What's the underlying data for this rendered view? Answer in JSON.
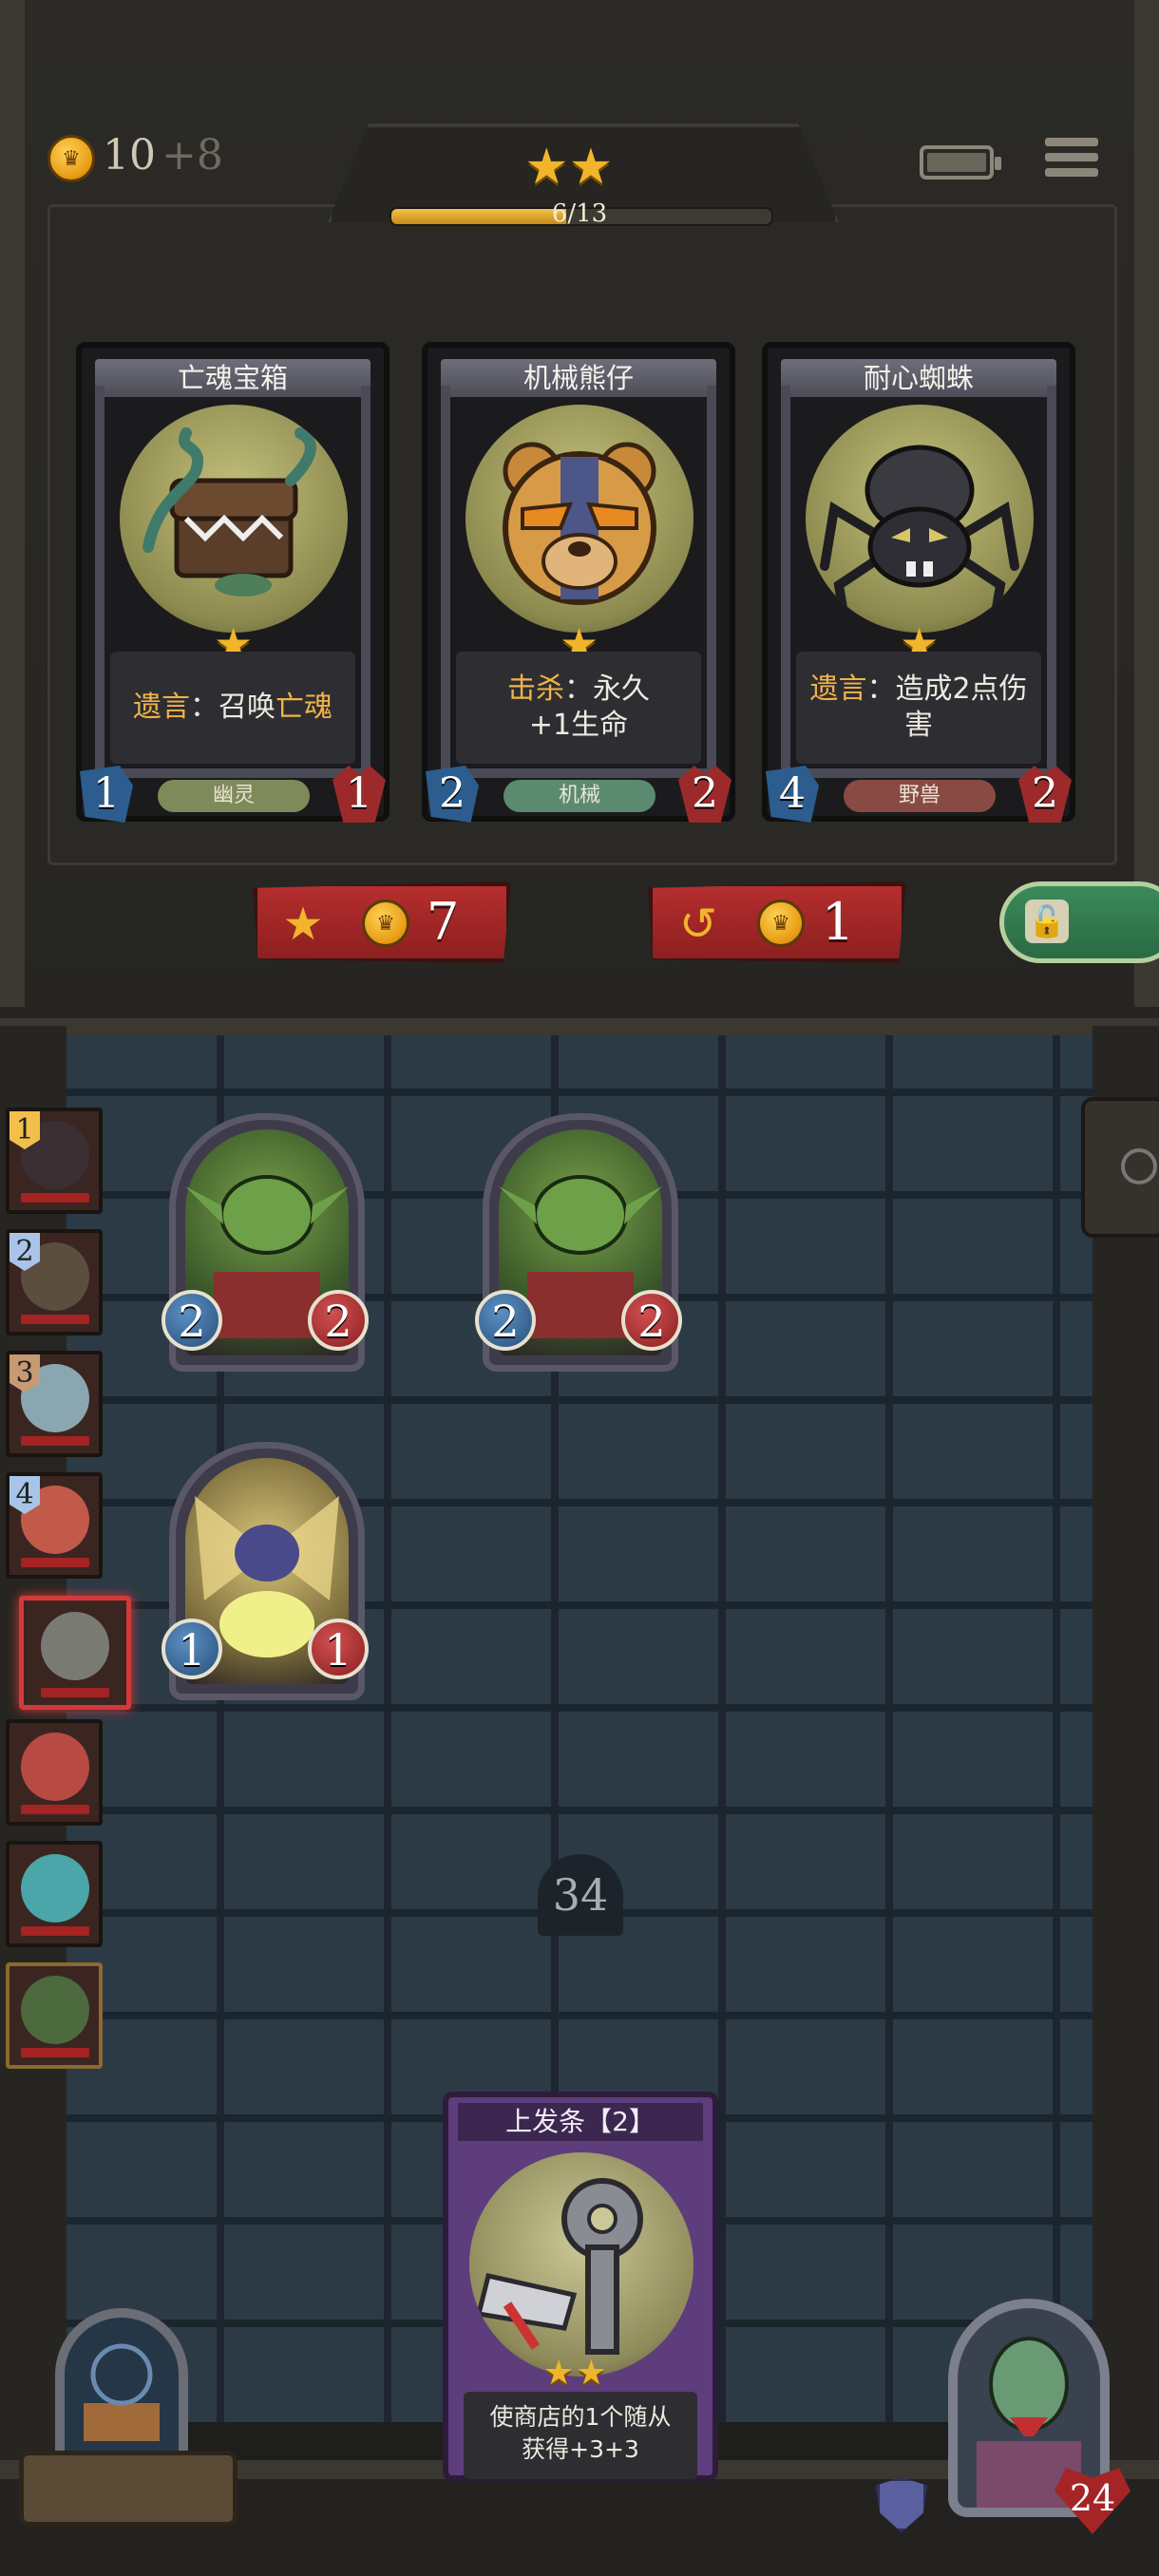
{
  "hud": {
    "gold": "10",
    "gold_income": "+8",
    "tier_stars": "★★",
    "xp_text": "6/13",
    "xp_progress": 0.46
  },
  "shop": {
    "cards": [
      {
        "name": "亡魂宝箱",
        "desc_kw": "遗言",
        "desc_rest": "：召唤",
        "desc_kw2": "亡魂",
        "tribe": "幽灵",
        "attack": "1",
        "health": "1",
        "tribe_color": "#7f8a5a"
      },
      {
        "name": "机械熊仔",
        "desc_kw": "击杀",
        "desc_rest": "：永久",
        "desc_line2": "+1生命",
        "tribe": "机械",
        "attack": "2",
        "health": "2",
        "tribe_color": "#5b8a70"
      },
      {
        "name": "耐心蜘蛛",
        "desc_kw": "遗言",
        "desc_rest": "：造成2点伤害",
        "tribe": "野兽",
        "attack": "4",
        "health": "2",
        "tribe_color": "#8a4a44"
      }
    ],
    "upgrade_cost": "7",
    "reroll_cost": "1"
  },
  "opponents": [
    {
      "rank": "1",
      "rank_color": "#f2c04a",
      "face": "#3a3034"
    },
    {
      "rank": "2",
      "rank_color": "#a8c4e8",
      "face": "#5b4e3e"
    },
    {
      "rank": "3",
      "rank_color": "#c69a72",
      "face": "#8aa6b0"
    },
    {
      "rank": "4",
      "rank_color": "#a8c4e8",
      "face": "#c25a4a"
    },
    {
      "rank": "",
      "rank_color": "",
      "face": "#7a7a74"
    },
    {
      "rank": "",
      "rank_color": "",
      "face": "#b84a44"
    },
    {
      "rank": "",
      "rank_color": "",
      "face": "#4aa6a8"
    },
    {
      "rank": "",
      "rank_color": "",
      "face": "#4c6a3e"
    }
  ],
  "board": {
    "minions": [
      {
        "attack": "2",
        "health": "2"
      },
      {
        "attack": "2",
        "health": "2"
      },
      {
        "attack": "1",
        "health": "1"
      }
    ],
    "deck_count": "34"
  },
  "hand": {
    "title": "上发条【2】",
    "stars": "★★",
    "desc_line1": "使商店的1个随从",
    "desc_line2": "获得+3+3"
  },
  "hero": {
    "health": "24"
  }
}
